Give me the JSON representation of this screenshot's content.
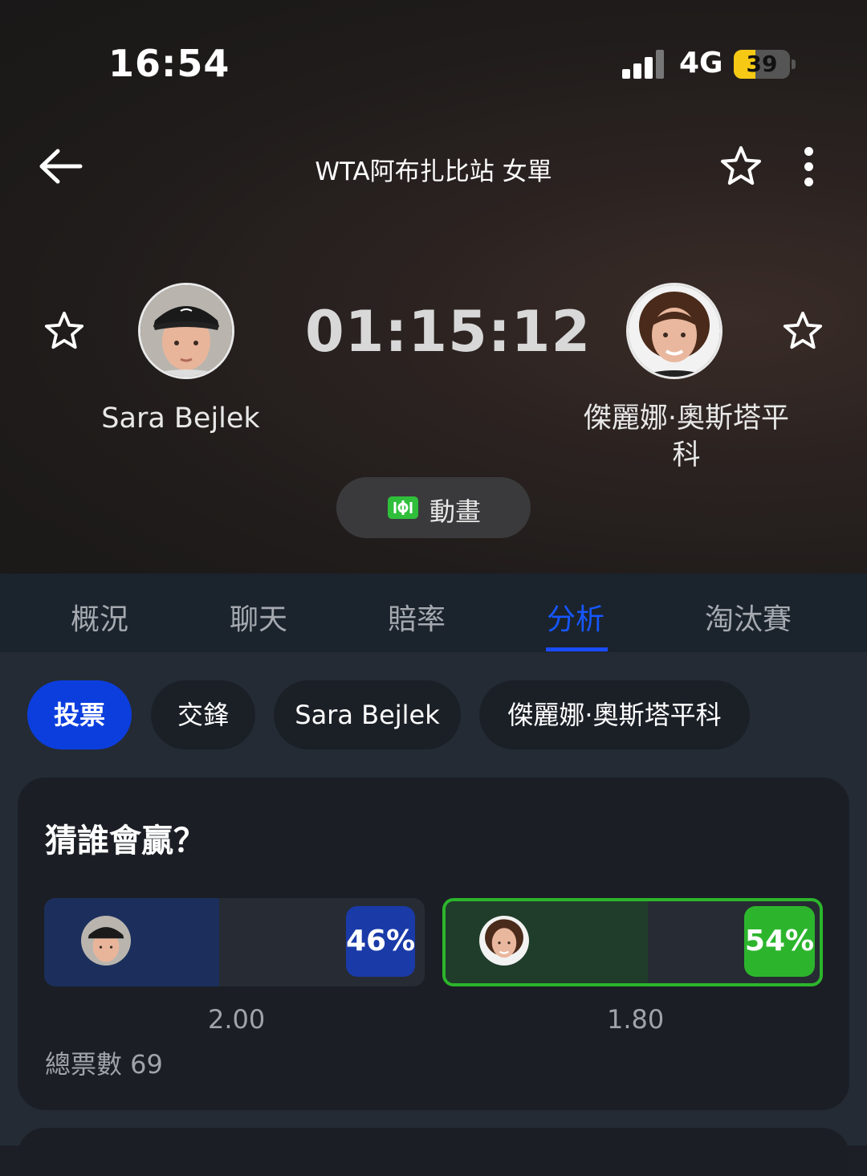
{
  "status_bar": {
    "time": "16:54",
    "network": "4G",
    "battery": "39",
    "battery_level": 0.39
  },
  "header": {
    "title": "WTA阿布扎比站 女單"
  },
  "match": {
    "timer": "01:15:12",
    "player1": {
      "name": "Sara Bejlek"
    },
    "player2": {
      "name_line1": "傑麗娜·奧斯塔平",
      "name_line2": "科"
    },
    "animation_label": "動畫"
  },
  "tabs": [
    {
      "label": "概況"
    },
    {
      "label": "聊天"
    },
    {
      "label": "賠率"
    },
    {
      "label": "分析",
      "active": true
    },
    {
      "label": "淘汰賽"
    }
  ],
  "chips": [
    {
      "label": "投票",
      "active": true
    },
    {
      "label": "交鋒"
    },
    {
      "label": "Sara Bejlek"
    },
    {
      "label": "傑麗娜·奧斯塔平科"
    }
  ],
  "vote": {
    "title": "猜誰會贏？",
    "player1": {
      "percent": "46%",
      "value": 0.46,
      "odds": "2.00"
    },
    "player2": {
      "percent": "54%",
      "value": 0.54,
      "odds": "1.80"
    },
    "total": "總票數 69"
  },
  "colors": {
    "accent_blue": "#0c3ede",
    "tab_active": "#1557ff",
    "vote_green": "#2cb52c",
    "vote_blue": "#1a3aa8"
  }
}
